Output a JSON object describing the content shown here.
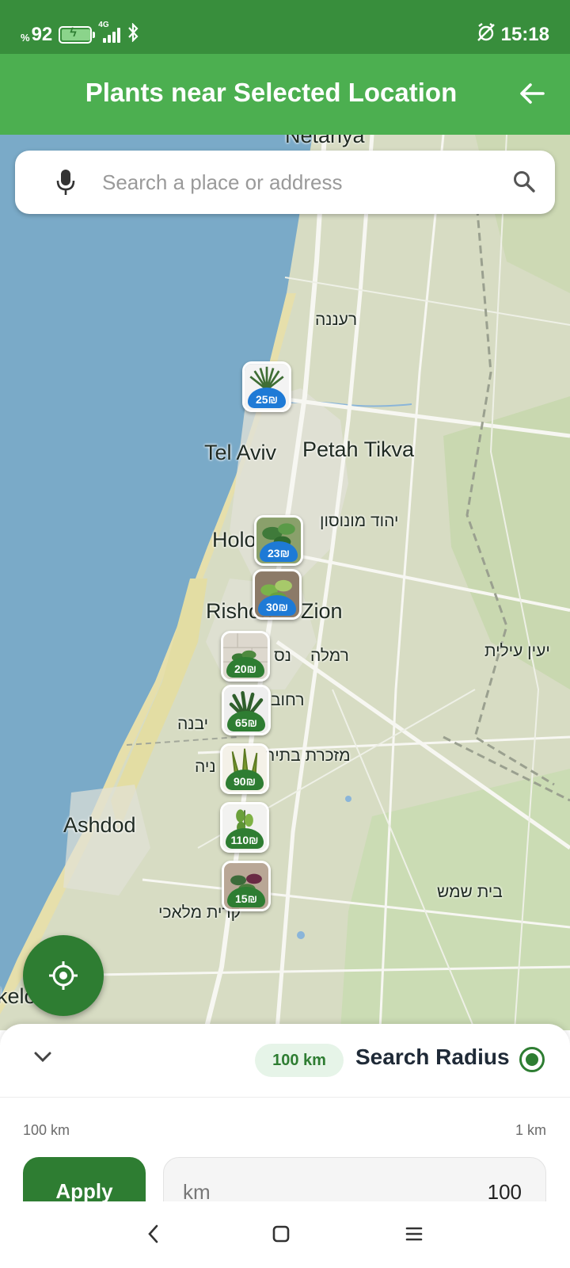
{
  "status_bar": {
    "battery_percent_sign": "%",
    "battery_level": "92",
    "network_type": "4G",
    "time": "15:18",
    "icons": [
      "battery-charging-icon",
      "signal-icon",
      "bluetooth-icon",
      "alarm-off-icon"
    ]
  },
  "app_bar": {
    "title": "Plants near Selected Location",
    "back_icon": "arrow-back-icon"
  },
  "search": {
    "placeholder": "Search a place or address",
    "value": "",
    "icons": [
      "mic-icon",
      "search-icon"
    ]
  },
  "map": {
    "places": [
      {
        "name": "Netanya"
      },
      {
        "name": "רעננה"
      },
      {
        "name": "Tel Aviv"
      },
      {
        "name": "Petah Tikva"
      },
      {
        "name": "יהוד מונוסון"
      },
      {
        "name": "Holo"
      },
      {
        "name": "Rishon"
      },
      {
        "name": "Zion"
      },
      {
        "name": "נס"
      },
      {
        "name": "רמלה"
      },
      {
        "name": "רחוב"
      },
      {
        "name": "יבנה"
      },
      {
        "name": "מזכרת בתיר"
      },
      {
        "name": "ניה"
      },
      {
        "name": "Ashdod"
      },
      {
        "name": "בית שמש"
      },
      {
        "name": "קרית מלאכי"
      },
      {
        "name": "kelon"
      },
      {
        "name": "יעין עילית"
      }
    ],
    "markers": [
      {
        "price": "25₪",
        "color": "blue"
      },
      {
        "price": "23₪",
        "color": "blue"
      },
      {
        "price": "30₪",
        "color": "blue"
      },
      {
        "price": "20₪",
        "color": "green"
      },
      {
        "price": "65₪",
        "color": "green"
      },
      {
        "price": "90₪",
        "color": "green"
      },
      {
        "price": "110₪",
        "color": "green"
      },
      {
        "price": "15₪",
        "color": "green"
      }
    ],
    "locate_icon": "my-location-icon"
  },
  "bottom_sheet": {
    "collapse_icon": "chevron-down-icon",
    "radius_chip": "100 km",
    "title": "Search Radius",
    "selected": true,
    "slider_max_label": "100 km",
    "slider_min_label": "1 km",
    "apply_label": "Apply",
    "km_unit": "km",
    "km_value": "100"
  },
  "nav_bar": {
    "icons": [
      "nav-back-icon",
      "nav-home-icon",
      "nav-menu-icon"
    ]
  },
  "colors": {
    "status_bar": "#388e3c",
    "app_bar": "#4caf50",
    "primary": "#2e7d32",
    "marker_blue": "#1e7ad6",
    "sea": "#7aaac8",
    "land": "#d7dcc3"
  }
}
